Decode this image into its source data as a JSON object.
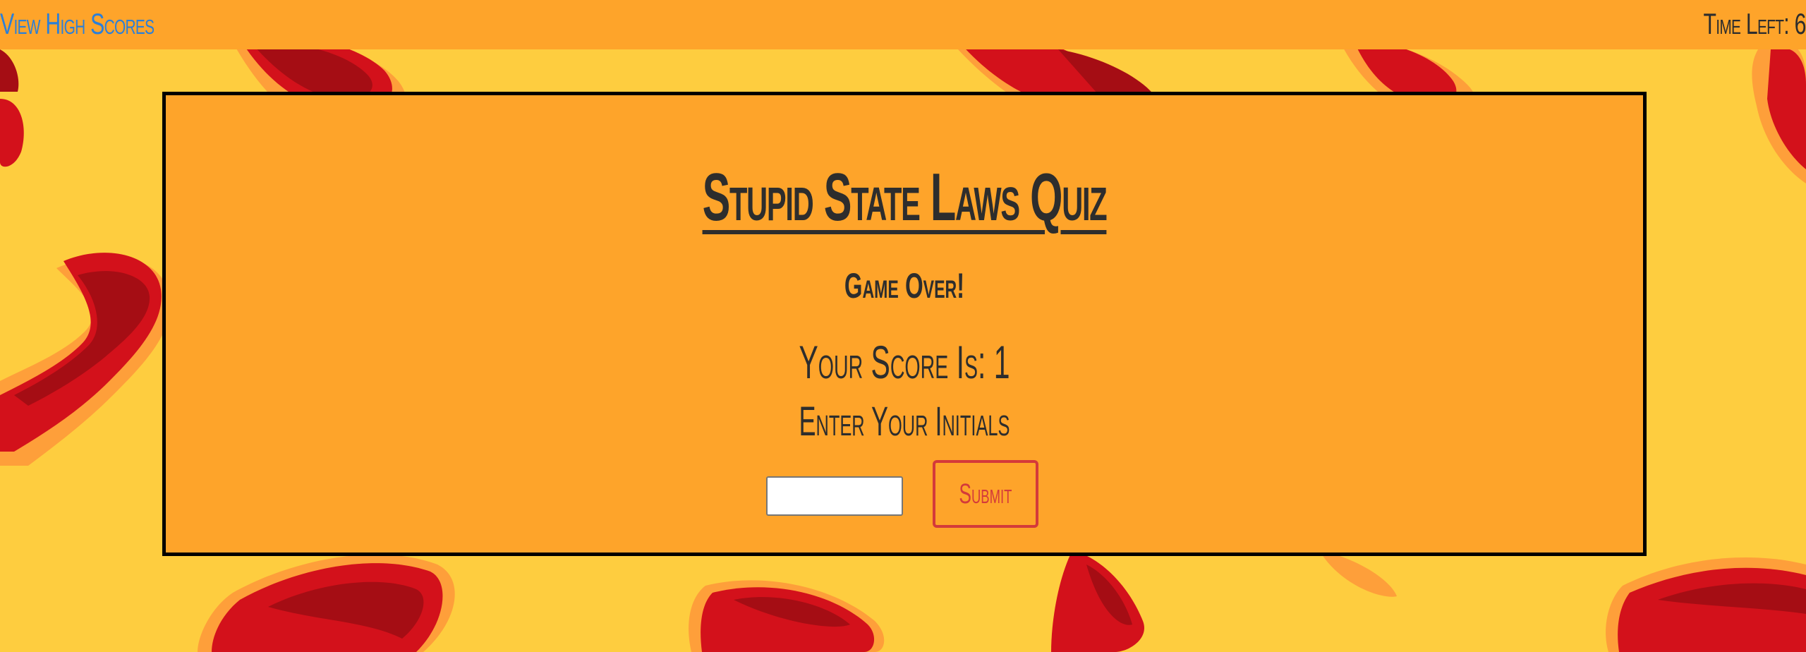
{
  "header": {
    "high_scores_label": "View High Scores",
    "timer_label": "Time Left: 6"
  },
  "quiz": {
    "title": "Stupid State Laws Quiz",
    "game_over_text": "Game Over!",
    "score_text": "Your Score Is: 1",
    "initials_label": "Enter Your Initials",
    "initials_value": "",
    "submit_label": "Submit"
  },
  "colors": {
    "page_background": "#fecd3f",
    "header_background": "#fea42a",
    "card_background": "#fea42a",
    "link": "#2b7fd8",
    "text": "#2d2d2d",
    "submit_accent": "#d43a3a",
    "decor_dark_red": "#a50d14",
    "decor_red": "#d3111b",
    "decor_orange": "#fe9f3a"
  }
}
